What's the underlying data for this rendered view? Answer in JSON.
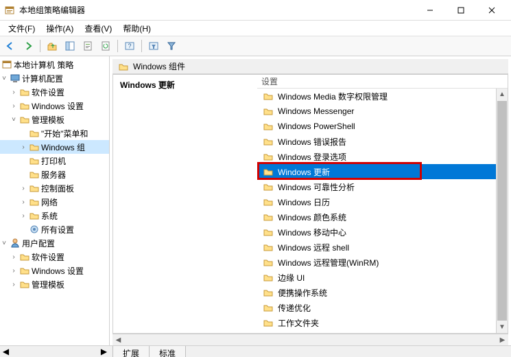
{
  "window": {
    "title": "本地组策略编辑器"
  },
  "menu": {
    "file": "文件(F)",
    "action": "操作(A)",
    "view": "查看(V)",
    "help": "帮助(H)"
  },
  "tree": {
    "root": "本地计算机 策略",
    "computerConfig": "计算机配置",
    "softwareSettings": "软件设置",
    "windowsSettings": "Windows 设置",
    "adminTemplates": "管理模板",
    "startMenu": "\"开始\"菜单和",
    "windowsComp": "Windows 组",
    "printers": "打印机",
    "server": "服务器",
    "controlPanel": "控制面板",
    "network": "网络",
    "system": "系统",
    "allSettings": "所有设置",
    "userConfig": "用户配置",
    "userSoftware": "软件设置",
    "userWindows": "Windows 设置",
    "userAdmin": "管理模板"
  },
  "crumb": {
    "label": "Windows 组件"
  },
  "detailHeader": "Windows 更新",
  "settingsHeader": "设置",
  "items": [
    "Windows Media 数字权限管理",
    "Windows Messenger",
    "Windows PowerShell",
    "Windows 错误报告",
    "Windows 登录选项",
    "Windows 更新",
    "Windows 可靠性分析",
    "Windows 日历",
    "Windows 颜色系统",
    "Windows 移动中心",
    "Windows 远程 shell",
    "Windows 远程管理(WinRM)",
    "边缘 UI",
    "便携操作系统",
    "传递优化",
    "工作文件夹"
  ],
  "selectedIndex": 5,
  "tabs": {
    "ext": "扩展",
    "std": "标准"
  }
}
